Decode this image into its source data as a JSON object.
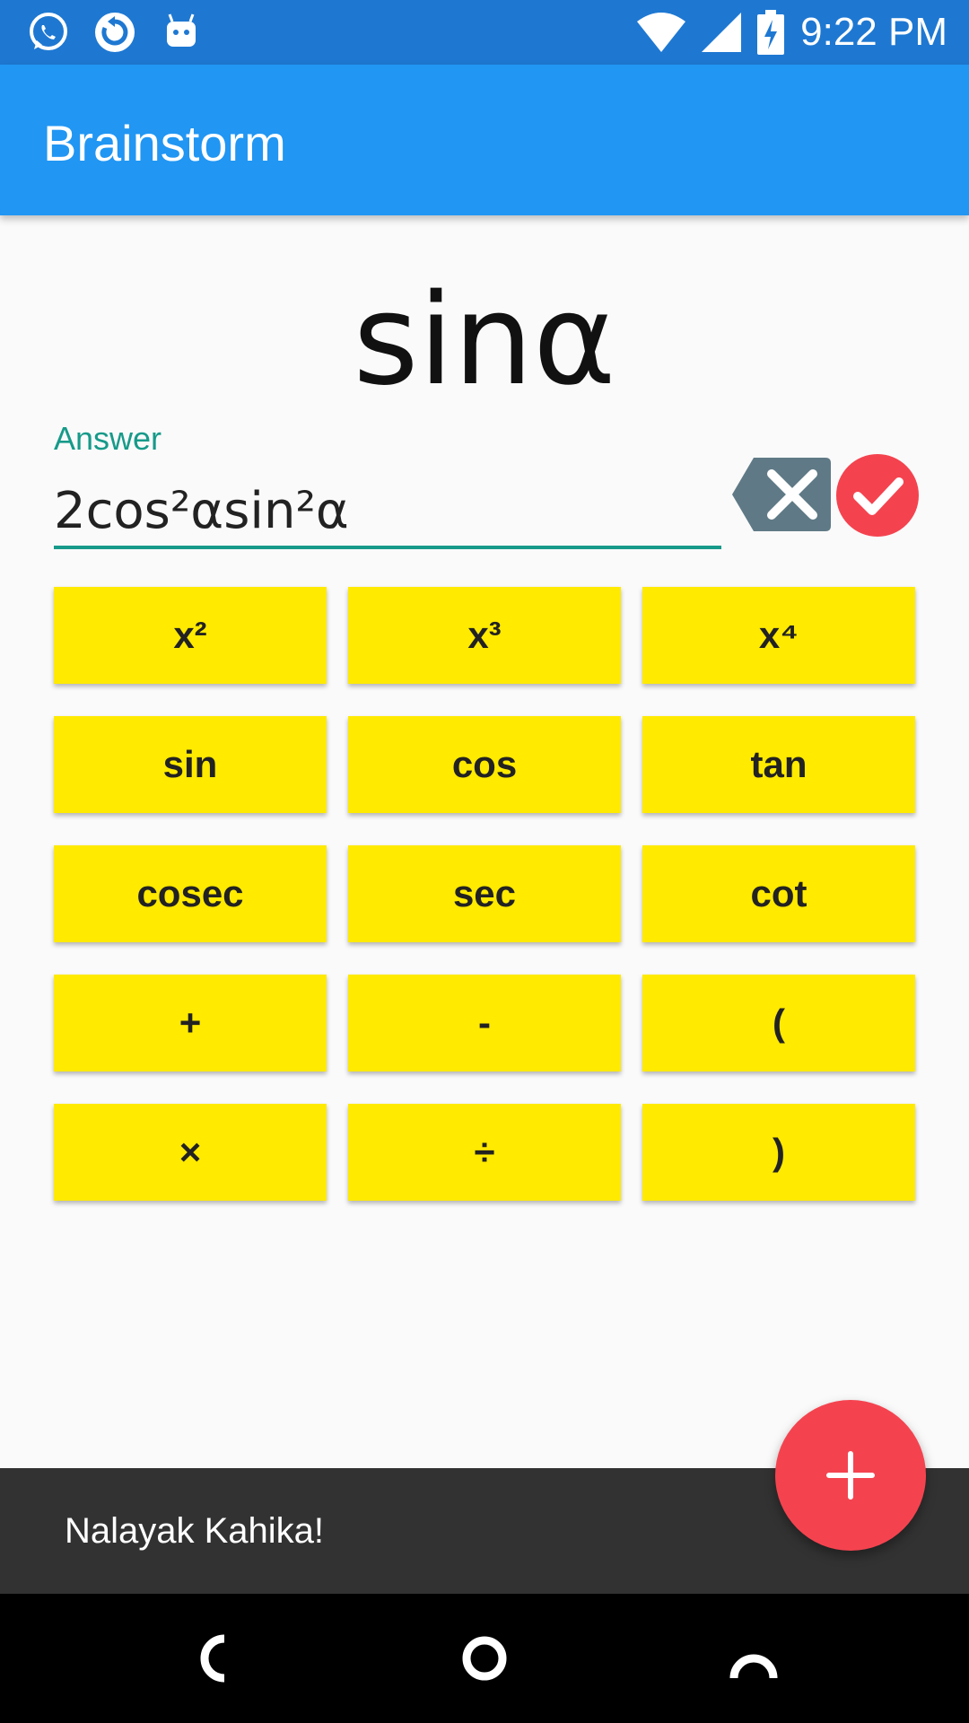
{
  "status_bar": {
    "time": "9:22 PM",
    "icons": [
      "whatsapp-icon",
      "sync-icon",
      "android-icon",
      "wifi-icon",
      "signal-icon",
      "battery-charging-icon"
    ]
  },
  "app_bar": {
    "title": "Brainstorm"
  },
  "question": {
    "text": "sinα"
  },
  "answer": {
    "label": "Answer",
    "value": "2cos²αsin²α"
  },
  "actions": {
    "backspace_icon": "backspace-icon",
    "check_icon": "check-icon"
  },
  "keypad": {
    "keys": [
      "x²",
      "x³",
      "x⁴",
      "sin",
      "cos",
      "tan",
      "cosec",
      "sec",
      "cot",
      "+",
      "-",
      "(",
      "×",
      "÷",
      ")"
    ]
  },
  "snackbar": {
    "message": "Nalayak Kahika!"
  },
  "fab": {
    "icon": "plus-icon"
  },
  "nav_bar": {
    "icons": [
      "back-icon",
      "home-icon",
      "recents-icon"
    ]
  },
  "colors": {
    "status_bar": "#1e78d2",
    "app_bar": "#2196f3",
    "accent": "#179a8a",
    "key": "#ffea00",
    "danger": "#f4434f",
    "snackbar": "#323232"
  }
}
